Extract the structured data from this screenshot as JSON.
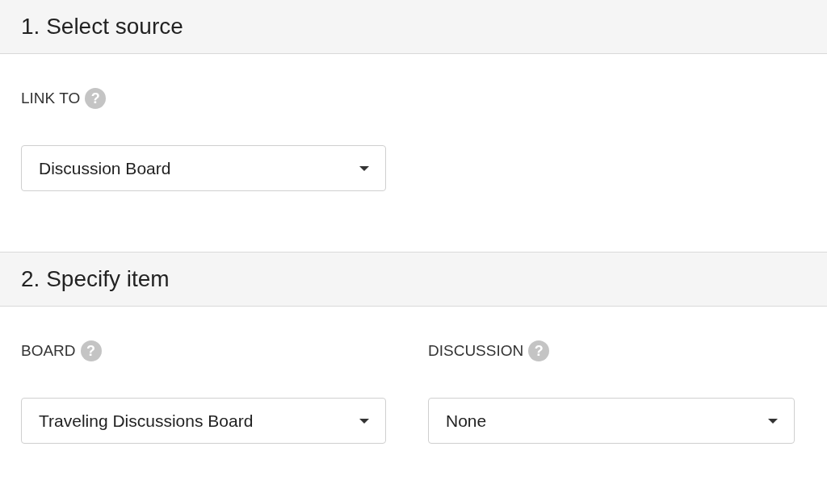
{
  "sections": [
    {
      "title": "1. Select source",
      "fields": [
        {
          "label": "LINK TO",
          "help": "?",
          "value": "Discussion Board"
        }
      ]
    },
    {
      "title": "2. Specify item",
      "fields": [
        {
          "label": "BOARD",
          "help": "?",
          "value": "Traveling Discussions Board"
        },
        {
          "label": "DISCUSSION",
          "help": "?",
          "value": "None"
        }
      ]
    }
  ]
}
